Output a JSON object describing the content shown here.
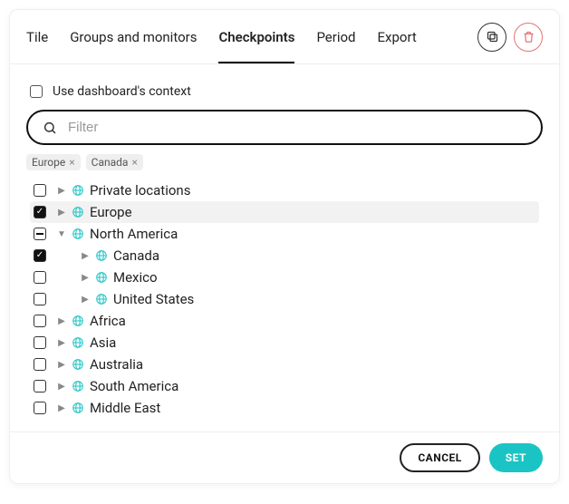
{
  "tabs": [
    "Tile",
    "Groups and monitors",
    "Checkpoints",
    "Period",
    "Export"
  ],
  "active_tab_index": 2,
  "context_checkbox_label": "Use dashboard's context",
  "filter_placeholder": "Filter",
  "chips": [
    "Europe",
    "Canada"
  ],
  "tree": [
    {
      "label": "Private locations",
      "depth": 0,
      "check": "unchecked",
      "expanded": false,
      "selected": false
    },
    {
      "label": "Europe",
      "depth": 0,
      "check": "checked",
      "expanded": false,
      "selected": true
    },
    {
      "label": "North America",
      "depth": 0,
      "check": "indeterminate",
      "expanded": true,
      "selected": false
    },
    {
      "label": "Canada",
      "depth": 1,
      "check": "checked",
      "expanded": false,
      "selected": false
    },
    {
      "label": "Mexico",
      "depth": 1,
      "check": "unchecked",
      "expanded": false,
      "selected": false
    },
    {
      "label": "United States",
      "depth": 1,
      "check": "unchecked",
      "expanded": false,
      "selected": false
    },
    {
      "label": "Africa",
      "depth": 0,
      "check": "unchecked",
      "expanded": false,
      "selected": false
    },
    {
      "label": "Asia",
      "depth": 0,
      "check": "unchecked",
      "expanded": false,
      "selected": false
    },
    {
      "label": "Australia",
      "depth": 0,
      "check": "unchecked",
      "expanded": false,
      "selected": false
    },
    {
      "label": "South America",
      "depth": 0,
      "check": "unchecked",
      "expanded": false,
      "selected": false
    },
    {
      "label": "Middle East",
      "depth": 0,
      "check": "unchecked",
      "expanded": false,
      "selected": false
    }
  ],
  "buttons": {
    "cancel": "CANCEL",
    "set": "SET"
  },
  "colors": {
    "accent": "#1bc4c4",
    "globe": "#35c9c9",
    "danger": "#e57373"
  }
}
